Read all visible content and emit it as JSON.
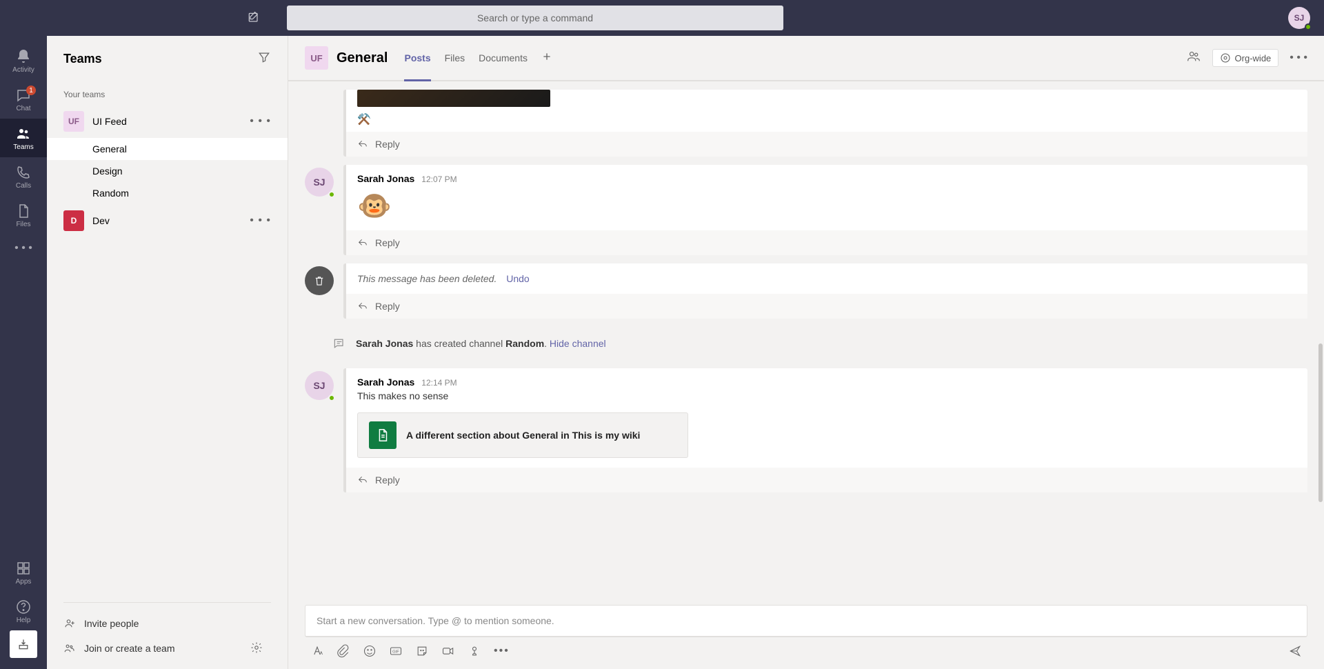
{
  "search": {
    "placeholder": "Search or type a command"
  },
  "profile": {
    "initials": "SJ"
  },
  "rail": {
    "activity": "Activity",
    "chat": "Chat",
    "chat_badge": "1",
    "teams": "Teams",
    "calls": "Calls",
    "files": "Files",
    "apps": "Apps",
    "help": "Help"
  },
  "teams_panel": {
    "title": "Teams",
    "section_label": "Your teams",
    "teams": [
      {
        "initials": "UF",
        "name": "UI Feed",
        "avatar_bg": "#f0d8ef",
        "avatar_fg": "#8a5a88",
        "channels": [
          "General",
          "Design",
          "Random"
        ],
        "active_channel": 0
      },
      {
        "initials": "D",
        "name": "Dev",
        "avatar_bg": "#cc2e44",
        "avatar_fg": "#ffffff",
        "channels": []
      }
    ],
    "invite": "Invite people",
    "join_create": "Join or create a team"
  },
  "channel_header": {
    "team_initials": "UF",
    "title": "General",
    "tabs": [
      "Posts",
      "Files",
      "Documents"
    ],
    "active_tab": 0,
    "org_tag": "Org-wide"
  },
  "messages": {
    "m1": {
      "reply": "Reply",
      "reaction": "⚒️"
    },
    "m2": {
      "author": "Sarah Jonas",
      "time": "12:07 PM",
      "emoji": "🐵",
      "reply": "Reply"
    },
    "m3": {
      "deleted_text": "This message has been deleted.",
      "undo": "Undo",
      "reply": "Reply"
    },
    "sys1": {
      "actor": "Sarah Jonas",
      "text1": " has created channel ",
      "channel": "Random",
      "text2": ". ",
      "hide": "Hide channel"
    },
    "m4": {
      "author": "Sarah Jonas",
      "time": "12:14 PM",
      "body": "This makes no sense",
      "wiki": "A different section about General in This is my wiki",
      "reply": "Reply"
    }
  },
  "composer": {
    "placeholder": "Start a new conversation. Type @ to mention someone."
  }
}
